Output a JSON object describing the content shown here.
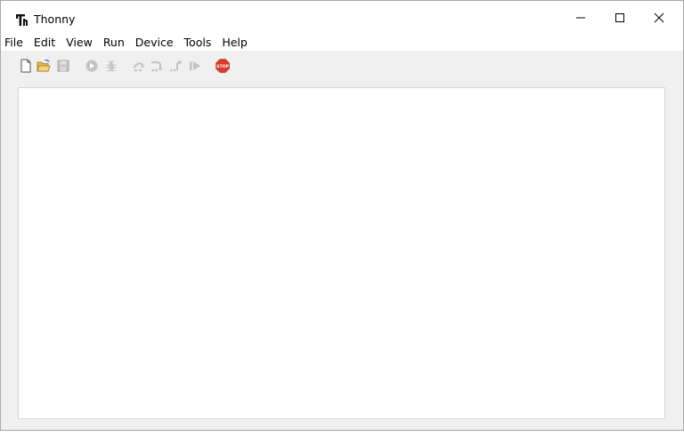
{
  "window": {
    "title": "Thonny"
  },
  "title_buttons": {
    "minimize_icon": "minimize-icon",
    "maximize_icon": "maximize-icon",
    "close_icon": "close-icon"
  },
  "menu": {
    "items": [
      "File",
      "Edit",
      "View",
      "Run",
      "Device",
      "Tools",
      "Help"
    ]
  },
  "toolbar": {
    "buttons": [
      {
        "icon": "new-file-icon"
      },
      {
        "icon": "open-folder-icon"
      },
      {
        "icon": "save-icon"
      },
      {
        "icon": "run-icon"
      },
      {
        "icon": "debug-icon"
      },
      {
        "icon": "step-over-icon"
      },
      {
        "icon": "step-into-icon"
      },
      {
        "icon": "step-out-icon"
      },
      {
        "icon": "resume-icon"
      },
      {
        "icon": "stop-icon",
        "label": "STOP"
      }
    ]
  },
  "colors": {
    "stop": "#e03a2f",
    "disabled": "#b8b8b8"
  }
}
